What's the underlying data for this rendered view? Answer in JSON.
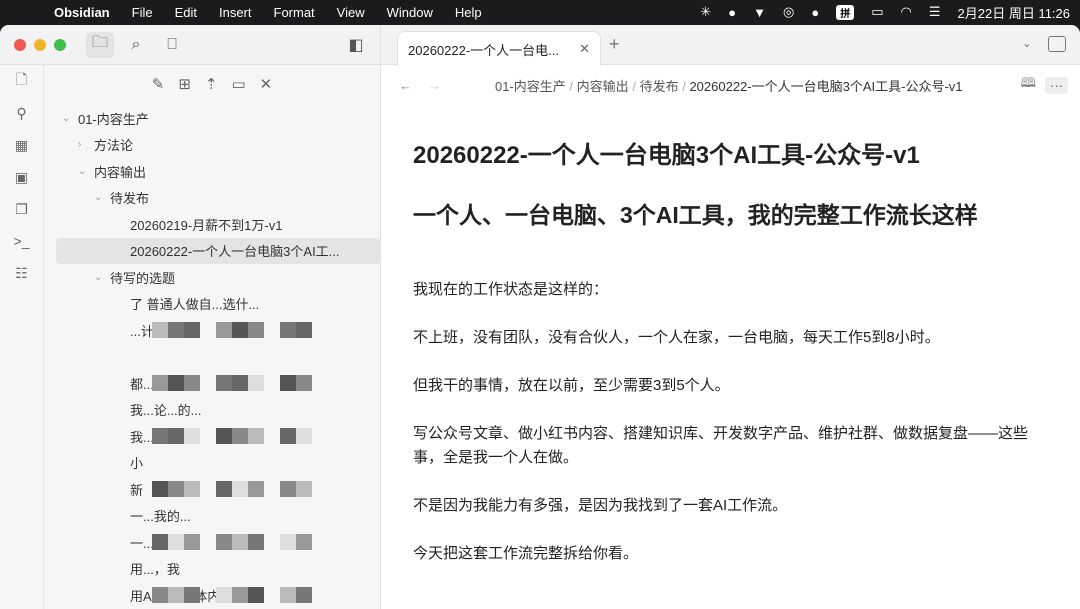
{
  "menubar": {
    "app": "Obsidian",
    "items": [
      "File",
      "Edit",
      "Insert",
      "Format",
      "View",
      "Window",
      "Help"
    ],
    "input_method": "拼",
    "datetime": "2月22日 周日  11:26"
  },
  "tab": {
    "title": "20260222-一个人一台电..."
  },
  "breadcrumb": [
    "01-内容生产",
    "内容输出",
    "待发布",
    "20260222-一个人一台电脑3个AI工具-公众号-v1"
  ],
  "tree": {
    "root": "01-内容生产",
    "f1": "方法论",
    "f2": "内容输出",
    "f3": "待发布",
    "file1": "20260219-月薪不到1万-v1",
    "file2": "20260222-一个人一台电脑3个AI工...",
    "f4": "待写的选题",
    "redacted": [
      "了 普通人做自...选什...",
      "...计...",
      "",
      "都...来...",
      "我...论...的...",
      "我...了...",
      "小",
      "新",
      "一...我的...",
      "一...的高...",
      "用...，我",
      "用AI做自媒体内容，我"
    ]
  },
  "doc": {
    "title": "20260222-一个人一台电脑3个AI工具-公众号-v1",
    "h2": "一个人、一台电脑、3个AI工具，我的完整工作流长这样",
    "paras": [
      "我现在的工作状态是这样的：",
      "不上班，没有团队，没有合伙人，一个人在家，一台电脑，每天工作5到8小时。",
      "但我干的事情，放在以前，至少需要3到5个人。",
      "写公众号文章、做小红书内容、搭建知识库、开发数字产品、维护社群、做数据复盘——这些事，全是我一个人在做。",
      "不是因为我能力有多强，是因为我找到了一套AI工作流。",
      "今天把这套工作流完整拆给你看。"
    ]
  }
}
